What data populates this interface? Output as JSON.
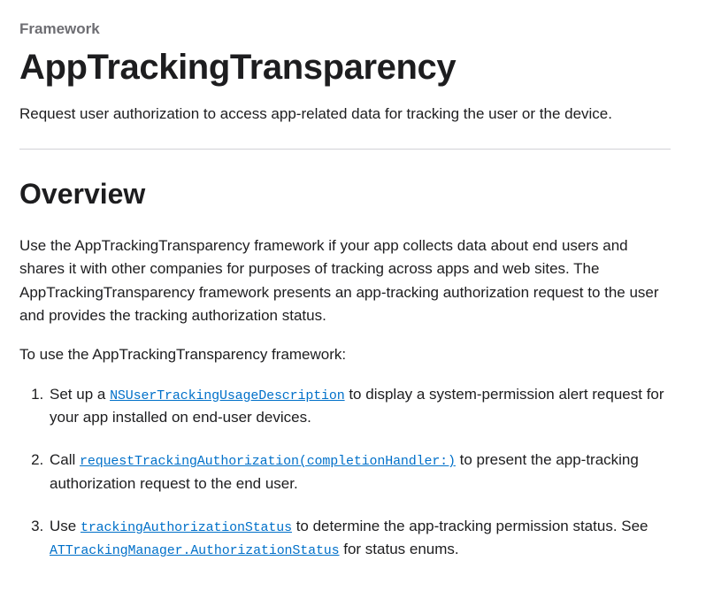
{
  "eyebrow": "Framework",
  "title": "AppTrackingTransparency",
  "summary": "Request user authorization to access app-related data for tracking the user or the device.",
  "overview": {
    "heading": "Overview",
    "para1": "Use the AppTrackingTransparency framework if your app collects data about end users and shares it with other companies for purposes of tracking across apps and web sites. The AppTrackingTransparency framework presents an app-tracking authorization request to the user and provides the tracking authorization status.",
    "intro": "To use the AppTrackingTransparency framework:",
    "steps": [
      {
        "pre": "Set up a ",
        "code": "NSUserTrackingUsageDescription",
        "post": " to display a system-permission alert request for your app installed on end-user devices."
      },
      {
        "pre": "Call ",
        "code": "requestTrackingAuthorization(completionHandler:)",
        "post": " to present the app-tracking authorization request to the end user."
      },
      {
        "pre": "Use ",
        "code": "trackingAuthorizationStatus",
        "mid": " to determine the app-tracking permission status. See ",
        "code2": "ATTrackingManager.AuthorizationStatus",
        "post": " for status enums."
      }
    ]
  }
}
